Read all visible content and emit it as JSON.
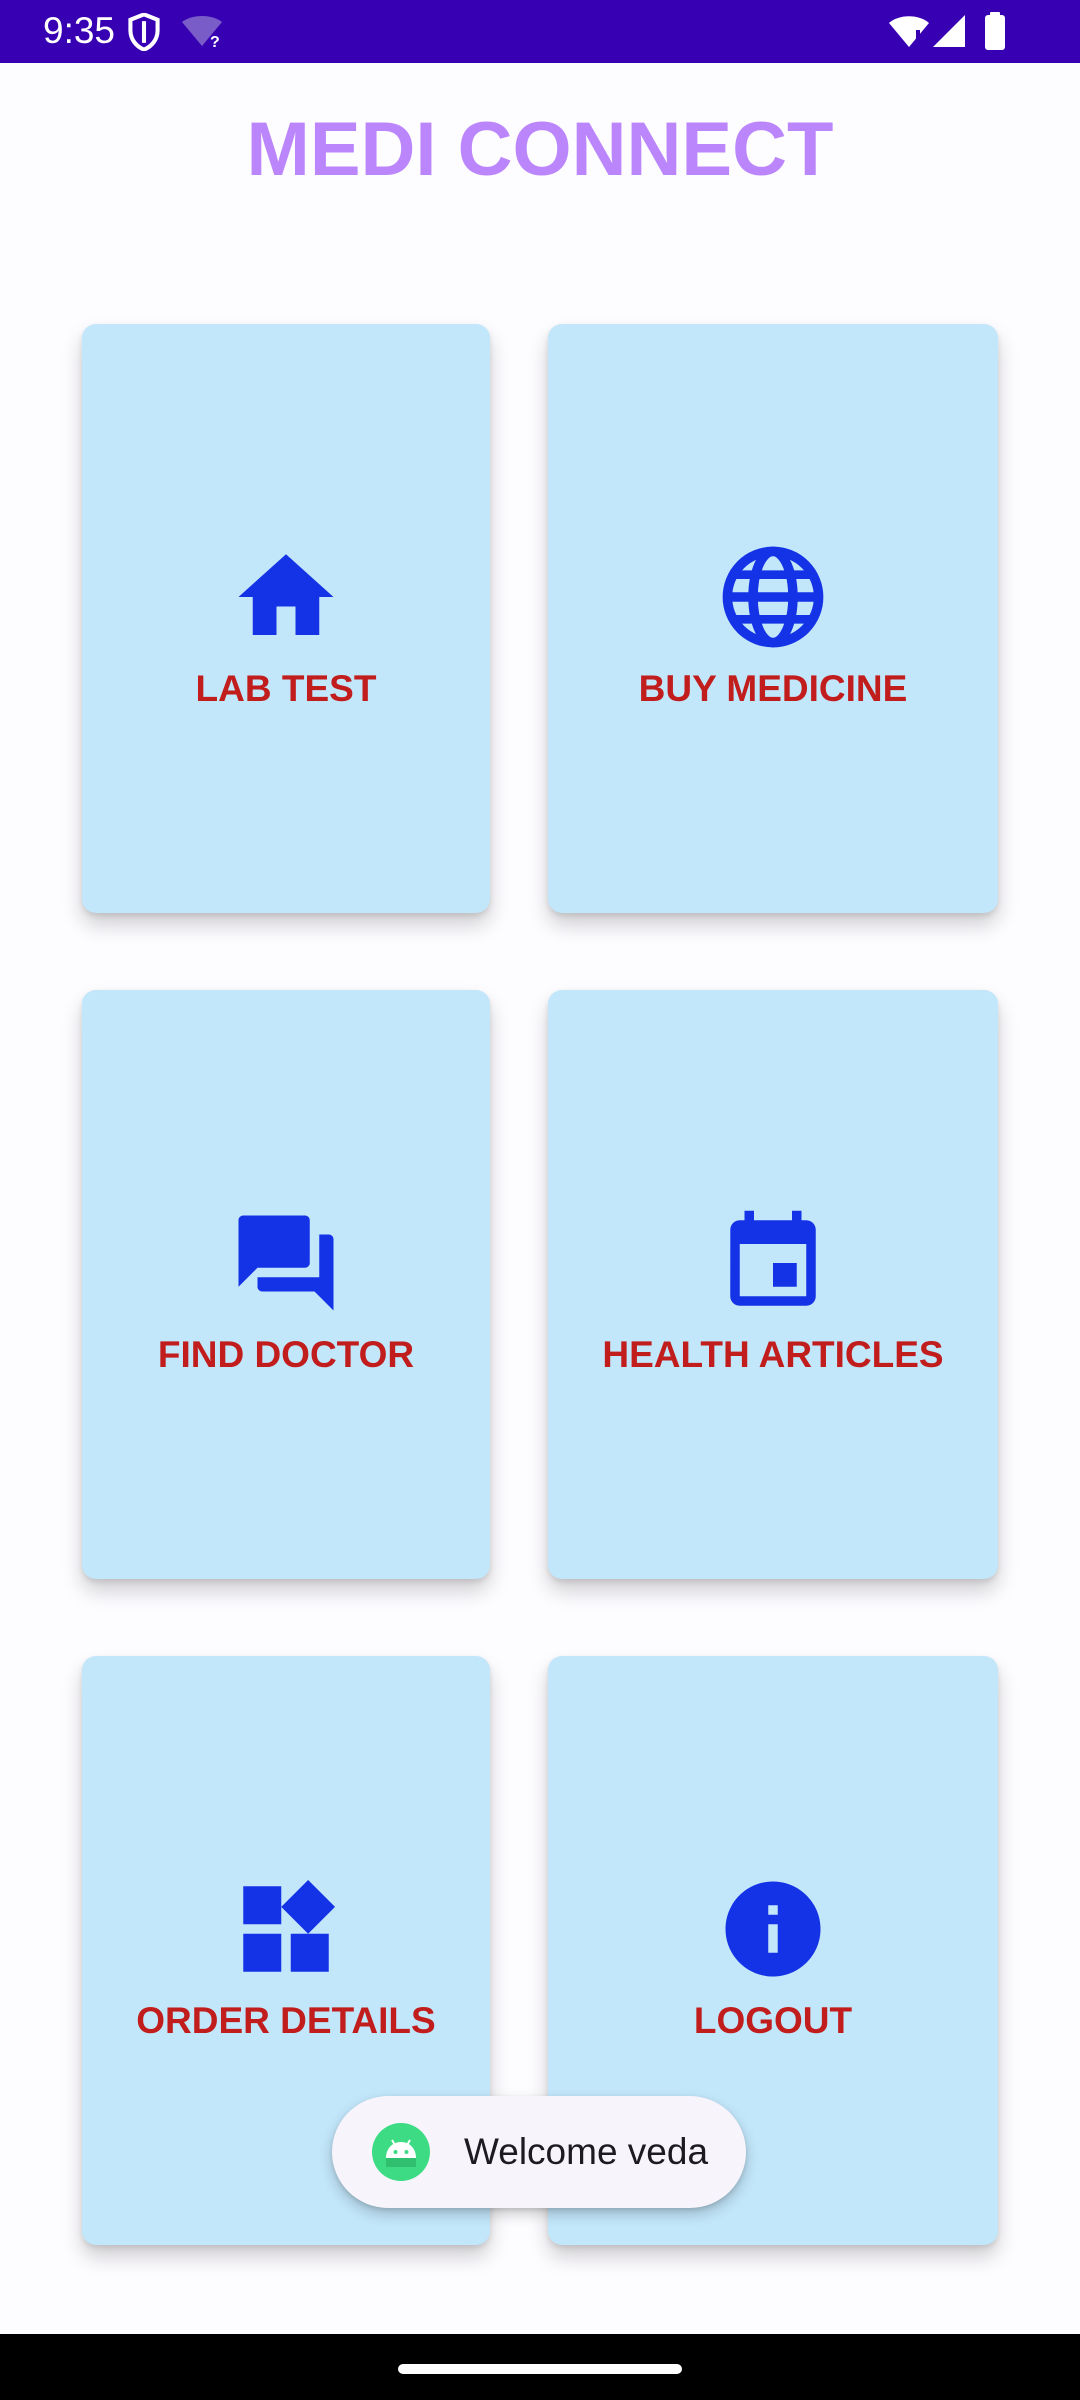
{
  "status_bar": {
    "time": "9:35",
    "icons": [
      "shield-icon",
      "wifi-question-icon",
      "wifi-alert-icon",
      "cellular-signal-icon",
      "battery-icon"
    ],
    "background_color": "#3700b3"
  },
  "app": {
    "title": "MEDI CONNECT",
    "title_color": "#bb86fc"
  },
  "tiles": [
    {
      "label": "LAB TEST",
      "icon": "home-icon"
    },
    {
      "label": "BUY MEDICINE",
      "icon": "globe-icon"
    },
    {
      "label": "FIND DOCTOR",
      "icon": "chat-icon"
    },
    {
      "label": "HEALTH ARTICLES",
      "icon": "calendar-icon"
    },
    {
      "label": "ORDER DETAILS",
      "icon": "widgets-icon"
    },
    {
      "label": "LOGOUT",
      "icon": "info-icon"
    }
  ],
  "tile_style": {
    "background_color": "#c2e6fa",
    "icon_color": "#1432e6",
    "label_color": "#c21d1d"
  },
  "toast": {
    "message": "Welcome veda",
    "icon": "android-icon"
  }
}
